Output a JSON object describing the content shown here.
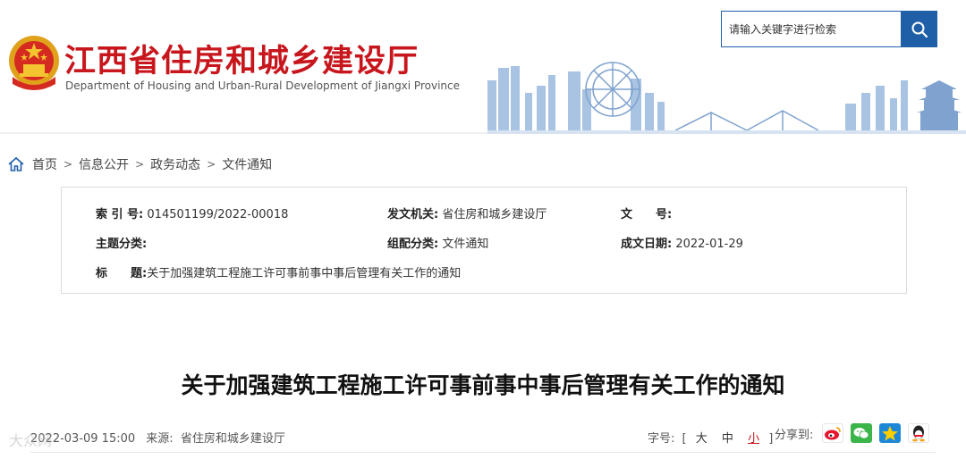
{
  "header": {
    "title": "江西省住房和城乡建设厅",
    "subtitle": "Department of Housing and Urban-Rural Development of Jiangxi Province",
    "search_placeholder": "请输入关键字进行检索"
  },
  "breadcrumb": [
    "首页",
    "信息公开",
    "政务动态",
    "文件通知"
  ],
  "meta": {
    "index_label": "索 引 号:",
    "index_value": "014501199/2022-00018",
    "issuer_label": "发文机关:",
    "issuer_value": "省住房和城乡建设厅",
    "docno_label": "文　　号:",
    "docno_value": "",
    "topic_label": "主题分类:",
    "topic_value": "",
    "category_label": "组配分类:",
    "category_value": "文件通知",
    "date_label": "成文日期:",
    "date_value": "2022-01-29",
    "title_label": "标　　题:",
    "title_value": "关于加强建筑工程施工许可事前事中事后管理有关工作的通知"
  },
  "article": {
    "title": "关于加强建筑工程施工许可事前事中事后管理有关工作的通知",
    "datetime": "2022-03-09 15:00",
    "source_label": "来源:",
    "source_value": "省住房和城乡建设厅",
    "fontsize_label": "字号:",
    "fontsize_open": "[",
    "fontsize_options": [
      "大",
      "中",
      "小"
    ],
    "fontsize_close": "]",
    "share_label": "分享到:",
    "watermark": "大众网"
  },
  "colors": {
    "brand_red": "#c8161d",
    "accent_blue": "#1e5fa8",
    "text": "#333333"
  },
  "icons": [
    "national-emblem-icon",
    "search-icon",
    "home-icon",
    "weibo-icon",
    "wechat-icon",
    "qzone-icon",
    "qq-icon"
  ]
}
